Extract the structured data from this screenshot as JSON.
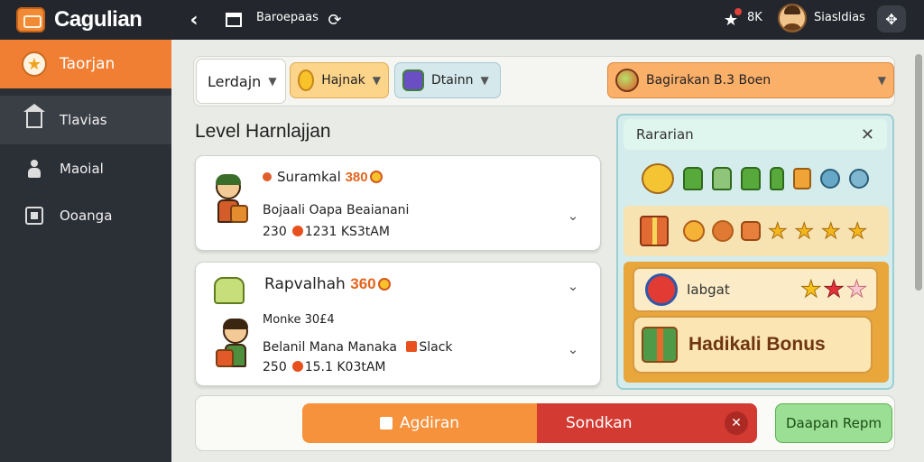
{
  "app": {
    "title": "Cagulian"
  },
  "topbar": {
    "page_label": "Baroepaas",
    "notif_count": "8K",
    "user_name": "Siasldias"
  },
  "sidebar": {
    "items": [
      {
        "label": "Taorjan",
        "icon": "star-icon"
      },
      {
        "label": "Tlavias",
        "icon": "house-icon"
      },
      {
        "label": "Maoial",
        "icon": "person-icon"
      },
      {
        "label": "Ooanga",
        "icon": "box-icon"
      }
    ]
  },
  "filters": {
    "level": "Lerdajn",
    "coin": "Hajnak",
    "gem": "Dtainn",
    "reward": "Bagirakan B.3 Boen"
  },
  "main": {
    "title": "Level Harnlajjan",
    "cards": [
      {
        "title": "Suramkal",
        "points": "380",
        "line1": "Bojaali Oapa Beaianani",
        "line2_num": "230",
        "line2_rest": "1231 KS3tAM"
      },
      {
        "title": "Rapvalhah",
        "points": "360",
        "line1": "Monke 30£4",
        "line2": "Belanil Mana Manaka",
        "line2_tail": "Slack",
        "line3_num": "250",
        "line3_rest": "15.1 K03tAM"
      }
    ]
  },
  "panel": {
    "title": "Rararian",
    "scroll1_label": "Iabgat",
    "bonus_label": "Hadikali Bonus"
  },
  "actions": {
    "primary": "Agdiran",
    "secondary": "Sondkan",
    "tertiary": "Daapan Repm"
  }
}
